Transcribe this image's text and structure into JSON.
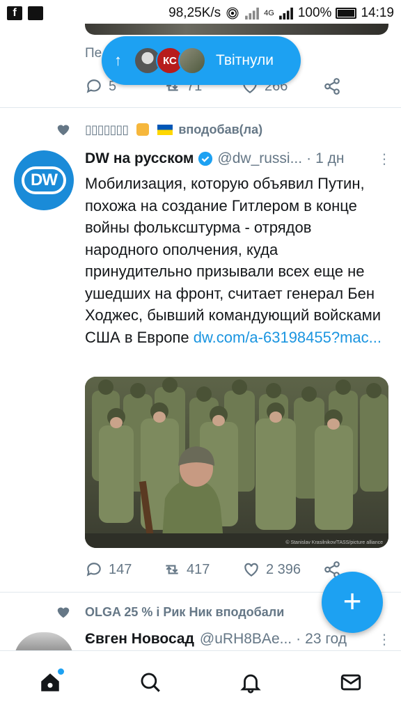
{
  "status_bar": {
    "speed": "98,25K/s",
    "network": "4G",
    "battery": "100%",
    "time": "14:19"
  },
  "top_tweet": {
    "partial_text": "Пе",
    "replies": "5",
    "retweets": "71",
    "likes": "266"
  },
  "new_tweets_pill": {
    "label": "Твітнули",
    "avatar_badge": "КС"
  },
  "tweet1": {
    "context": "вподобав(ла)",
    "context_name": "▯▯▯▯▯▯▯",
    "author_name": "DW на русском",
    "author_handle": "@dw_russi...",
    "time": "1 дн",
    "avatar_label": "DW",
    "text": "Мобилизация, которую объявил Путин, похожа на создание Гитлером в конце войны фольксштурма - отрядов народного ополчения, куда принудительно призывали всех еще не ушедших на фронт, считает генерал Бен Ходжес, бывший командующий войсками США в Европе ",
    "link": "dw.com/a-63198455?mac...",
    "image_credit": "© Stanislav Krasilnikov/TASS/picture alliance",
    "replies": "147",
    "retweets": "417",
    "likes": "2 396"
  },
  "tweet2": {
    "context": "OLGA 25 % і Рик Ник вподобали",
    "author_name": "Євген Новосад",
    "author_handle": "@uRH8BAe...",
    "time": "23 год"
  },
  "fab_label": "+",
  "colors": {
    "accent": "#1da1f2",
    "muted": "#657786",
    "link": "#1b95e0"
  }
}
